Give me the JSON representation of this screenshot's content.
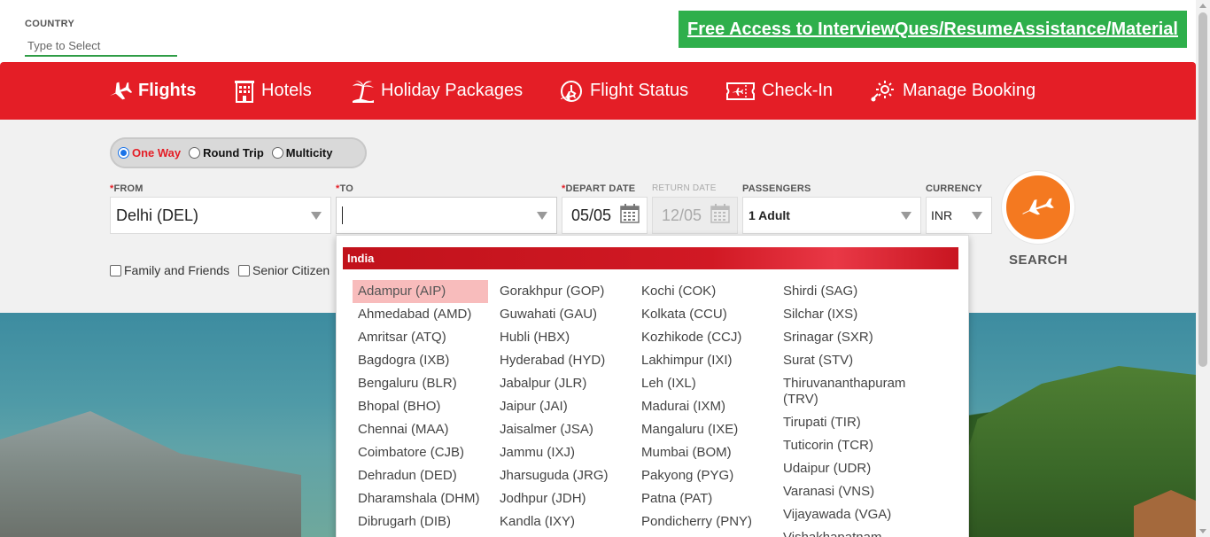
{
  "top": {
    "country_label": "COUNTRY",
    "country_placeholder": "Type to Select",
    "promo_link": "Free Access to InterviewQues/ResumeAssistance/Material"
  },
  "nav": {
    "items": [
      {
        "label": "Flights",
        "icon": "airplane-icon",
        "active": true
      },
      {
        "label": "Hotels",
        "icon": "hotel-icon",
        "active": false
      },
      {
        "label": "Holiday Packages",
        "icon": "palm-tree-icon",
        "active": false
      },
      {
        "label": "Flight Status",
        "icon": "flight-status-icon",
        "active": false
      },
      {
        "label": "Check-In",
        "icon": "ticket-icon",
        "active": false
      },
      {
        "label": "Manage Booking",
        "icon": "gear-icon",
        "active": false
      }
    ]
  },
  "trip_type": {
    "options": [
      {
        "label": "One Way",
        "checked": true
      },
      {
        "label": "Round Trip",
        "checked": false
      },
      {
        "label": "Multicity",
        "checked": false
      }
    ]
  },
  "form": {
    "from_label": "FROM",
    "from_value": "Delhi (DEL)",
    "to_label": "TO",
    "to_value": "",
    "depart_label": "DEPART DATE",
    "depart_value": "05/05",
    "return_label": "RETURN DATE",
    "return_value": "12/05",
    "passengers_label": "PASSENGERS",
    "passengers_value": "1 Adult",
    "currency_label": "CURRENCY",
    "currency_value": "INR",
    "required_mark": "*"
  },
  "options": {
    "family_friends": "Family and Friends",
    "senior_citizen": "Senior Citizen"
  },
  "search": {
    "label": "SEARCH"
  },
  "dropdown": {
    "group": "India",
    "columns": [
      [
        "Adampur (AIP)",
        "Ahmedabad (AMD)",
        "Amritsar (ATQ)",
        "Bagdogra (IXB)",
        "Bengaluru (BLR)",
        "Bhopal (BHO)",
        "Chennai (MAA)",
        "Coimbatore (CJB)",
        "Dehradun (DED)",
        "Dharamshala (DHM)",
        "Dibrugarh (DIB)"
      ],
      [
        "Gorakhpur (GOP)",
        "Guwahati (GAU)",
        "Hubli (HBX)",
        "Hyderabad (HYD)",
        "Jabalpur (JLR)",
        "Jaipur (JAI)",
        "Jaisalmer (JSA)",
        "Jammu (IXJ)",
        "Jharsuguda (JRG)",
        "Jodhpur (JDH)",
        "Kandla (IXY)"
      ],
      [
        "Kochi (COK)",
        "Kolkata (CCU)",
        "Kozhikode (CCJ)",
        "Lakhimpur (IXI)",
        "Leh (IXL)",
        "Madurai (IXM)",
        "Mangaluru (IXE)",
        "Mumbai (BOM)",
        "Pakyong (PYG)",
        "Patna (PAT)",
        "Pondicherry (PNY)"
      ],
      [
        "Shirdi (SAG)",
        "Silchar (IXS)",
        "Srinagar (SXR)",
        "Surat (STV)",
        "Thiruvananthapuram (TRV)",
        "Tirupati (TIR)",
        "Tuticorin (TCR)",
        "Udaipur (UDR)",
        "Varanasi (VNS)",
        "Vijayawada (VGA)",
        "Vishakhapatnam"
      ]
    ],
    "highlighted": "Adampur (AIP)"
  },
  "colors": {
    "brand_red": "#e41e26",
    "promo_green": "#2eaf4b",
    "search_orange": "#f47920",
    "highlight_pink": "#f8bcbc"
  }
}
